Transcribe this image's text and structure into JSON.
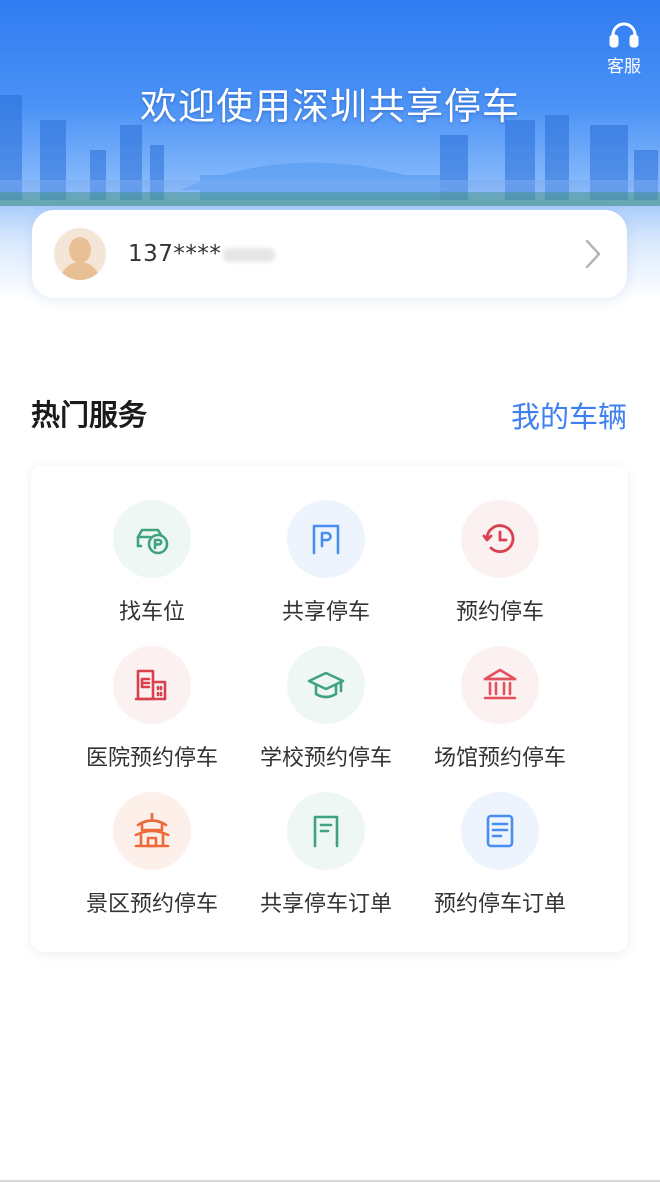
{
  "header": {
    "title": "欢迎使用深圳共享停车",
    "customer_service_label": "客服",
    "customer_service_icon": "headset-icon"
  },
  "user": {
    "phone_masked": "137****",
    "avatar_icon": "user-avatar-icon",
    "arrow_icon": "chevron-right-icon"
  },
  "section": {
    "title": "热门服务",
    "my_vehicles_link": "我的车辆"
  },
  "services": [
    {
      "label": "找车位",
      "icon": "find-parking-icon",
      "color": "#3fa37e",
      "bg": "#eef7f4"
    },
    {
      "label": "共享停车",
      "icon": "shared-parking-icon",
      "color": "#4a8df0",
      "bg": "#edf4fd"
    },
    {
      "label": "预约停车",
      "icon": "reserve-clock-icon",
      "color": "#d9414e",
      "bg": "#fbf1f1"
    },
    {
      "label": "医院预约停车",
      "icon": "hospital-icon",
      "color": "#d9414e",
      "bg": "#fbf1f1"
    },
    {
      "label": "学校预约停车",
      "icon": "school-cap-icon",
      "color": "#3fa37e",
      "bg": "#eef7f4"
    },
    {
      "label": "场馆预约停车",
      "icon": "venue-building-icon",
      "color": "#e4505d",
      "bg": "#fbf1f1"
    },
    {
      "label": "景区预约停车",
      "icon": "scenic-pagoda-icon",
      "color": "#ec6a38",
      "bg": "#fdf0ea"
    },
    {
      "label": "共享停车订单",
      "icon": "shared-order-icon",
      "color": "#3fa37e",
      "bg": "#eef7f4"
    },
    {
      "label": "预约停车订单",
      "icon": "reserve-order-icon",
      "color": "#4a8df0",
      "bg": "#edf4fd"
    }
  ]
}
